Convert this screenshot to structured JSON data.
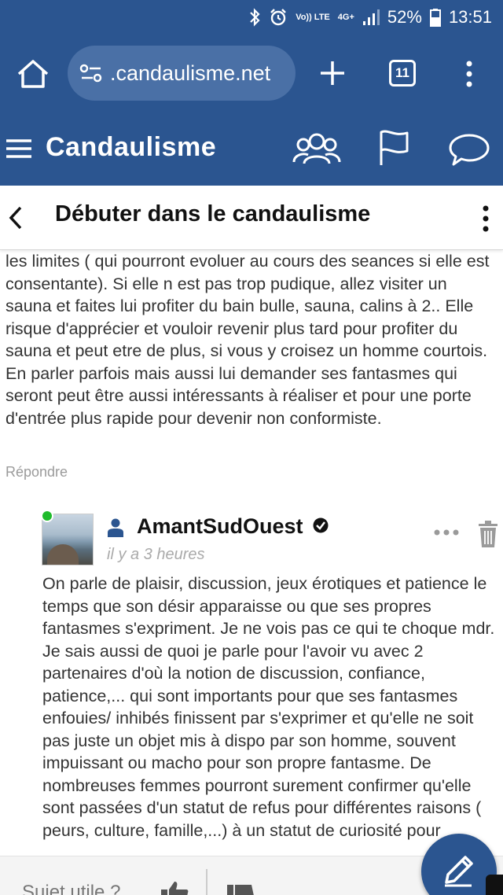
{
  "status_bar": {
    "volte": "Vo)) LTE",
    "network": "4G+",
    "battery": "52%",
    "time": "13:51"
  },
  "browser": {
    "url": ".candaulisme.net",
    "tab_count": "11"
  },
  "site": {
    "logo": "Candaulisme"
  },
  "topic": {
    "title": "Débuter dans le candaulisme"
  },
  "previous_post": {
    "text": "les limites ( qui pourront evoluer au cours des seances si elle est consentante). Si elle n est pas trop pudique, allez visiter un sauna et faites lui profiter du bain bulle, sauna, calins à 2.. Elle risque d'apprécier et vouloir revenir plus tard pour profiter du sauna et peut etre de plus, si vous y croisez un homme courtois. En parler parfois mais aussi lui demander ses fantasmes qui seront peut être aussi intéressants à réaliser et pour une porte d'entrée plus rapide pour devenir non conformiste.",
    "reply_label": "Répondre"
  },
  "comment": {
    "username": "AmantSudOuest",
    "timestamp": "il y a 3 heures",
    "text": "On parle de plaisir, discussion, jeux érotiques et patience le temps que son désir apparaisse ou que ses propres fantasmes s'expriment. Je ne vois pas ce qui te choque mdr. Je sais aussi de quoi je parle pour l'avoir vu avec 2 partenaires d'où la notion de discussion, confiance, patience,... qui sont importants pour que ses fantasmes enfouies/ inhibés finissent par s'exprimer et qu'elle ne soit pas juste un objet mis à dispo par son homme, souvent impuissant ou macho pour son propre fantasme. De nombreuses femmes pourront surement confirmer qu'elle sont passées d'un statut de refus pour différentes raisons ( peurs, culture, famille,...) à un statut de curiosité pour"
  },
  "bottom_bar": {
    "useful_label": "Sujet utile ?"
  },
  "colors": {
    "brand": "#2b5590",
    "online": "#1fbb2b"
  }
}
